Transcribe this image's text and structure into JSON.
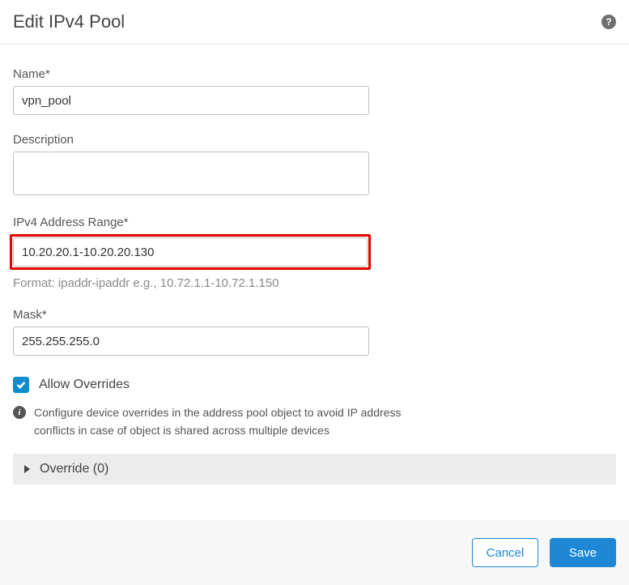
{
  "header": {
    "title": "Edit IPv4 Pool"
  },
  "form": {
    "name": {
      "label": "Name*",
      "value": "vpn_pool"
    },
    "description": {
      "label": "Description",
      "value": ""
    },
    "range": {
      "label": "IPv4 Address Range*",
      "value": "10.20.20.1-10.20.20.130",
      "hint": "Format: ipaddr-ipaddr e.g., 10.72.1.1-10.72.1.150"
    },
    "mask": {
      "label": "Mask*",
      "value": "255.255.255.0"
    },
    "allow_overrides": {
      "label": "Allow Overrides",
      "checked": true
    },
    "override_info": "Configure device overrides in the address pool object to avoid IP address conflicts in case of object is shared across multiple devices",
    "override_section": "Override (0)"
  },
  "footer": {
    "cancel": "Cancel",
    "save": "Save"
  }
}
